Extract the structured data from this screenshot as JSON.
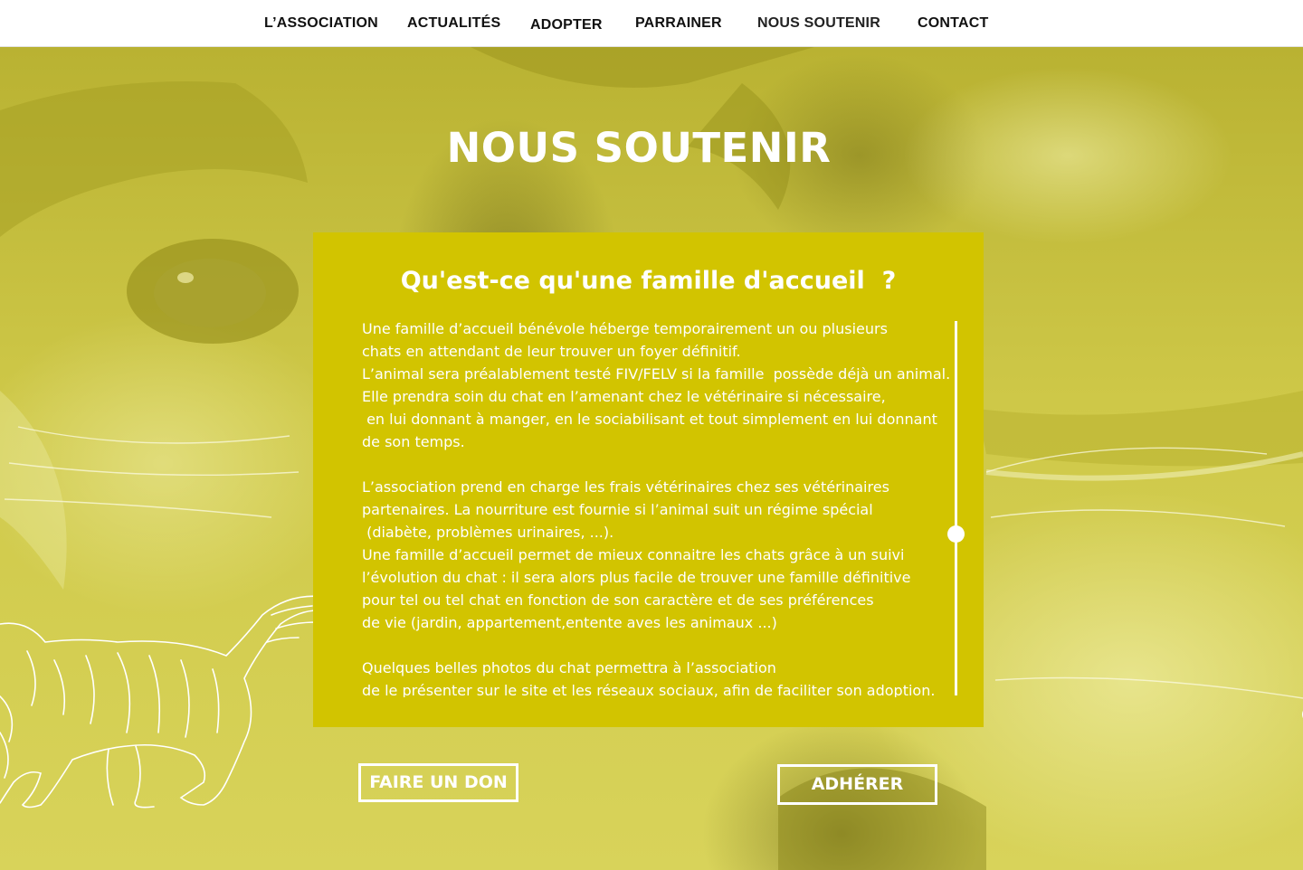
{
  "nav": {
    "items": [
      {
        "label": "L’ASSOCIATION"
      },
      {
        "label": "ACTUALITÉS"
      },
      {
        "label": "ADOPTER"
      },
      {
        "label": "PARRAINER"
      },
      {
        "label": "NOUS SOUTENIR",
        "active": true
      },
      {
        "label": "CONTACT"
      }
    ]
  },
  "hero": {
    "title": "NOUS SOUTENIR",
    "background_image": "yellow-tinted-kitten-photo",
    "illustration_icon": "cat-line-drawing-icon"
  },
  "panel": {
    "title": "Qu'est-ce qu'une famille d'accueil  ?",
    "lines": [
      "Une famille d’accueil bénévole héberge temporairement un ou plusieurs",
      "chats en attendant de leur trouver un foyer définitif.",
      "L’animal sera préalablement testé FIV/FELV si la famille  possède déjà un animal.",
      "Elle prendra soin du chat en l’amenant chez le vétérinaire si nécessaire,",
      " en lui donnant à manger, en le sociabilisant et tout simplement en lui donnant",
      "de son temps.",
      "",
      "L’association prend en charge les frais vétérinaires chez ses vétérinaires",
      "partenaires. La nourriture est fournie si l’animal suit un régime spécial",
      " (diabète, problèmes urinaires, ...).",
      "Une famille d’accueil permet de mieux connaitre les chats grâce à un suivi",
      "l’évolution du chat : il sera alors plus facile de trouver une famille définitive",
      "pour tel ou tel chat en fonction de son caractère et de ses préférences",
      "de vie (jardin, appartement,entente aves les animaux ...)",
      "",
      "Quelques belles photos du chat permettra à l’association",
      "de le présenter sur le site et les réseaux sociaux, afin de faciliter son adoption."
    ],
    "scroll_position": 0.57
  },
  "buttons": {
    "donate": "FAIRE UN DON",
    "join": "ADHÉRER"
  },
  "colors": {
    "nav_background": "#ffffff",
    "nav_text": "#111111",
    "panel_background": "#d2c400",
    "hero_tint": "#c7c13a",
    "text_on_tint": "#ffffff"
  }
}
